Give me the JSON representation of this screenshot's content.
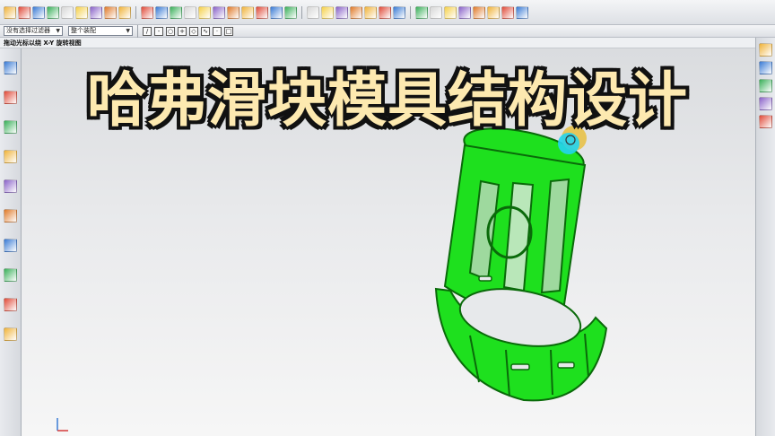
{
  "overlay": {
    "title": "哈弗滑块模具结构设计"
  },
  "toolbar_primary": {
    "icons": [
      "new-file-icon",
      "open-icon",
      "sketch-icon",
      "feature-icon",
      "blend-icon",
      "extrude-icon",
      "revolve-icon",
      "hole-icon",
      "boss-icon",
      "pocket-icon",
      "pad-icon",
      "slot-icon",
      "groove-icon",
      "unite-icon",
      "subtract-icon",
      "intersect-icon",
      "trim-body-icon",
      "split-body-icon",
      "shell-icon",
      "offset-face-icon",
      "draft-icon",
      "edge-blend-icon",
      "chamfer-icon",
      "mirror-icon",
      "pattern-icon",
      "datum-plane-icon",
      "datum-axis-icon",
      "line-icon",
      "arc-icon",
      "curve-icon",
      "spline-icon",
      "measure-icon",
      "analysis-icon",
      "section-icon",
      "view-icon"
    ]
  },
  "toolbar_secondary": {
    "type_filter": "没有选择过滤器",
    "scope_filter": "整个装配",
    "snap_icons": [
      "endpoint",
      "midpoint",
      "center",
      "intersection",
      "quadrant",
      "point-on-curve",
      "existing-point",
      "control-point"
    ]
  },
  "cue_line": {
    "text": "拖动光标以绕 X-Y 旋转视图"
  },
  "colors": {
    "part_green": "#1ee01e",
    "part_edge": "#0a6a0a",
    "highlight_cyan": "#22d4f0",
    "highlight_yellow": "#e8c040",
    "title_fill": "#fde9b0",
    "title_outline": "#111111"
  }
}
